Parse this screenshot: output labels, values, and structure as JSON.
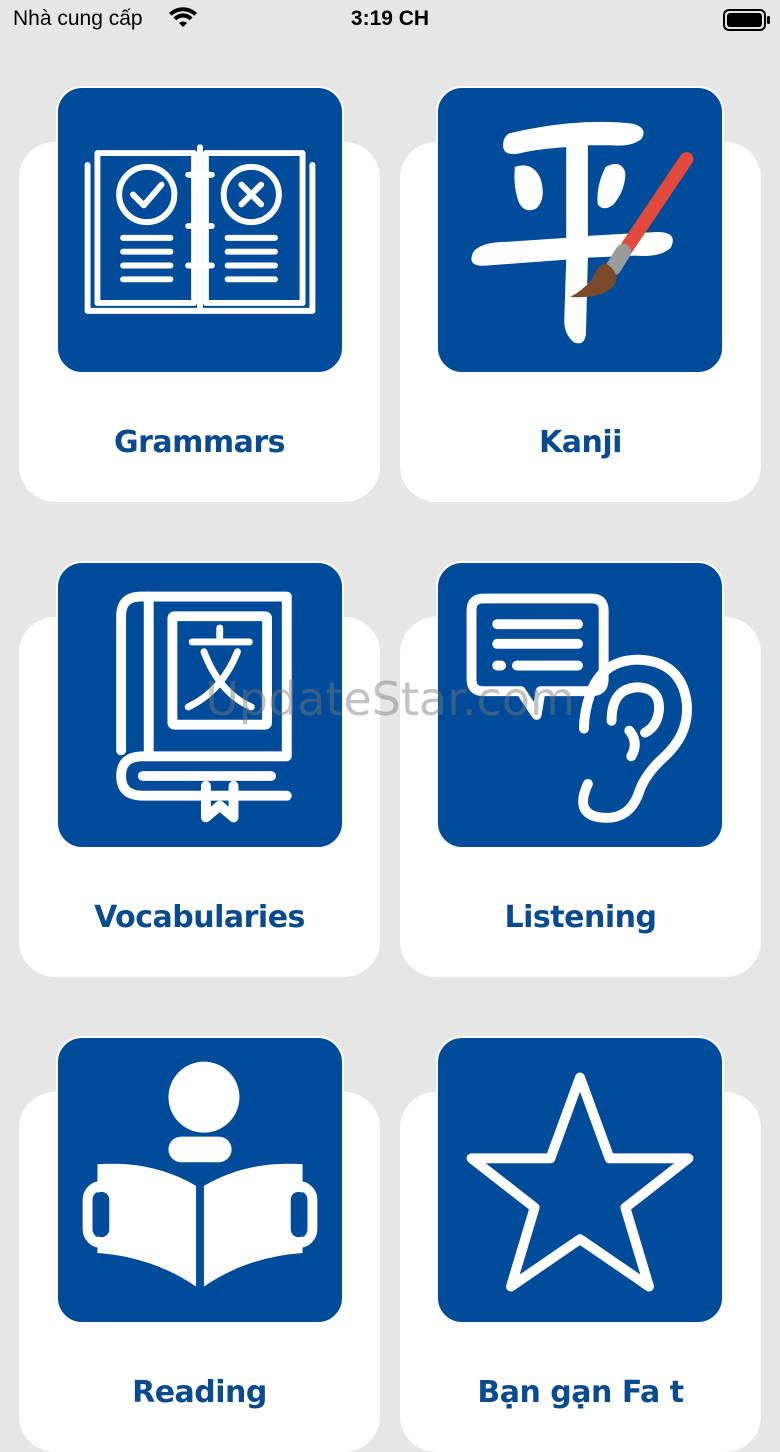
{
  "status_bar": {
    "carrier": "Nhà cung cấp",
    "time": "3:19 CH"
  },
  "colors": {
    "tile": "#014c9a",
    "label": "#0a4a8f",
    "background": "#e6e6e6",
    "brush_handle": "#e24a3b",
    "brush_tip": "#7a4a2a"
  },
  "menu": {
    "items": [
      {
        "label": "Grammars",
        "icon": "open-book-check-cross-icon"
      },
      {
        "label": "Kanji",
        "icon": "kanji-brush-icon"
      },
      {
        "label": "Vocabularies",
        "icon": "dictionary-book-icon"
      },
      {
        "label": "Listening",
        "icon": "speech-ear-icon"
      },
      {
        "label": "Reading",
        "icon": "person-reading-icon"
      },
      {
        "label": "Bạn gạn Fa t",
        "icon": "star-icon"
      }
    ]
  },
  "watermark": "UpdateStar.com"
}
